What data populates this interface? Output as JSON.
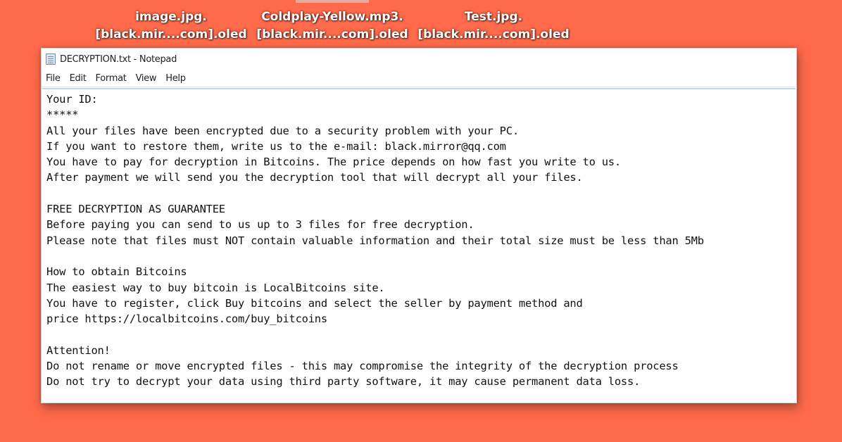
{
  "desktop": {
    "files": [
      {
        "line1": "image.jpg.",
        "line2": "[black.mir....com].oled"
      },
      {
        "line1": "Coldplay-Yellow.mp3.",
        "line2": "[black.mir....com].oled"
      },
      {
        "line1": "Test.jpg.",
        "line2": "[black.mir....com].oled"
      }
    ]
  },
  "window": {
    "title": "DECRYPTION.txt - Notepad",
    "icon": "notepad-icon",
    "menu": [
      "File",
      "Edit",
      "Format",
      "View",
      "Help"
    ],
    "content": "Your ID:\n*****\nAll your files have been encrypted due to a security problem with your PC.\nIf you want to restore them, write us to the e-mail: black.mirror@qq.com\nYou have to pay for decryption in Bitcoins. The price depends on how fast you write to us.\nAfter payment we will send you the decryption tool that will decrypt all your files.\n\nFREE DECRYPTION AS GUARANTEE\nBefore paying you can send to us up to 3 files for free decryption.\nPlease note that files must NOT contain valuable information and their total size must be less than 5Mb\n\nHow to obtain Bitcoins\nThe easiest way to buy bitcoin is LocalBitcoins site.\nYou have to register, click Buy bitcoins and select the seller by payment method and\nprice https://localbitcoins.com/buy_bitcoins\n\nAttention!\nDo not rename or move encrypted files - this may compromise the integrity of the decryption process\nDo not try to decrypt your data using third party software, it may cause permanent data loss."
  },
  "colors": {
    "desktop_background": "#ff6a4a",
    "window_background": "#ffffff",
    "text": "#111111"
  }
}
